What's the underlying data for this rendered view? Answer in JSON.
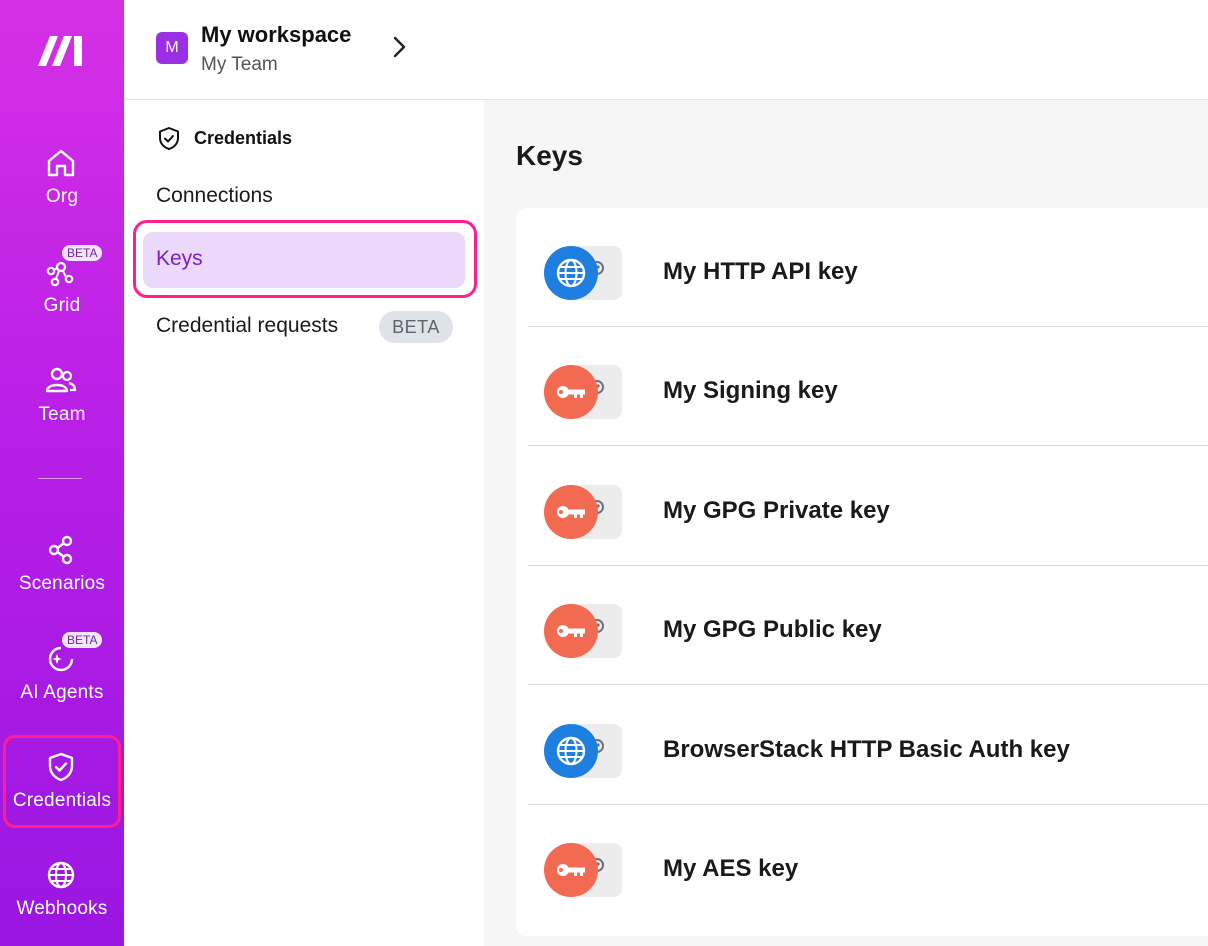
{
  "nav": {
    "items": [
      {
        "label": "Org",
        "icon": "home-icon"
      },
      {
        "label": "Grid",
        "icon": "grid-network-icon",
        "badge": "BETA"
      },
      {
        "label": "Team",
        "icon": "team-icon"
      },
      {
        "label": "Scenarios",
        "icon": "share-nodes-icon"
      },
      {
        "label": "AI Agents",
        "icon": "ai-agent-icon",
        "badge": "BETA"
      },
      {
        "label": "Credentials",
        "icon": "shield-check-icon"
      },
      {
        "label": "Webhooks",
        "icon": "globe-icon"
      }
    ]
  },
  "header": {
    "avatar_letter": "M",
    "workspace_name": "My workspace",
    "team_name": "My Team"
  },
  "subnav": {
    "title": "Credentials",
    "items": [
      {
        "label": "Connections"
      },
      {
        "label": "Keys"
      },
      {
        "label": "Credential requests",
        "badge": "BETA"
      }
    ]
  },
  "main": {
    "title": "Keys",
    "keys": [
      {
        "name": "My HTTP API key",
        "type_icon": "globe-icon",
        "color": "#1f7fe0"
      },
      {
        "name": "My Signing key",
        "type_icon": "key-icon",
        "color": "#f26a52"
      },
      {
        "name": "My GPG Private key",
        "type_icon": "key-icon",
        "color": "#f26a52"
      },
      {
        "name": "My GPG Public key",
        "type_icon": "key-icon",
        "color": "#f26a52"
      },
      {
        "name": "BrowserStack HTTP Basic Auth key",
        "type_icon": "globe-icon",
        "color": "#1f7fe0"
      },
      {
        "name": "My AES key",
        "type_icon": "key-icon",
        "color": "#f26a52"
      }
    ]
  },
  "colors": {
    "accent": "#9b2fe4",
    "highlight": "#ff1f8e",
    "active_bg": "#ead9fb"
  }
}
